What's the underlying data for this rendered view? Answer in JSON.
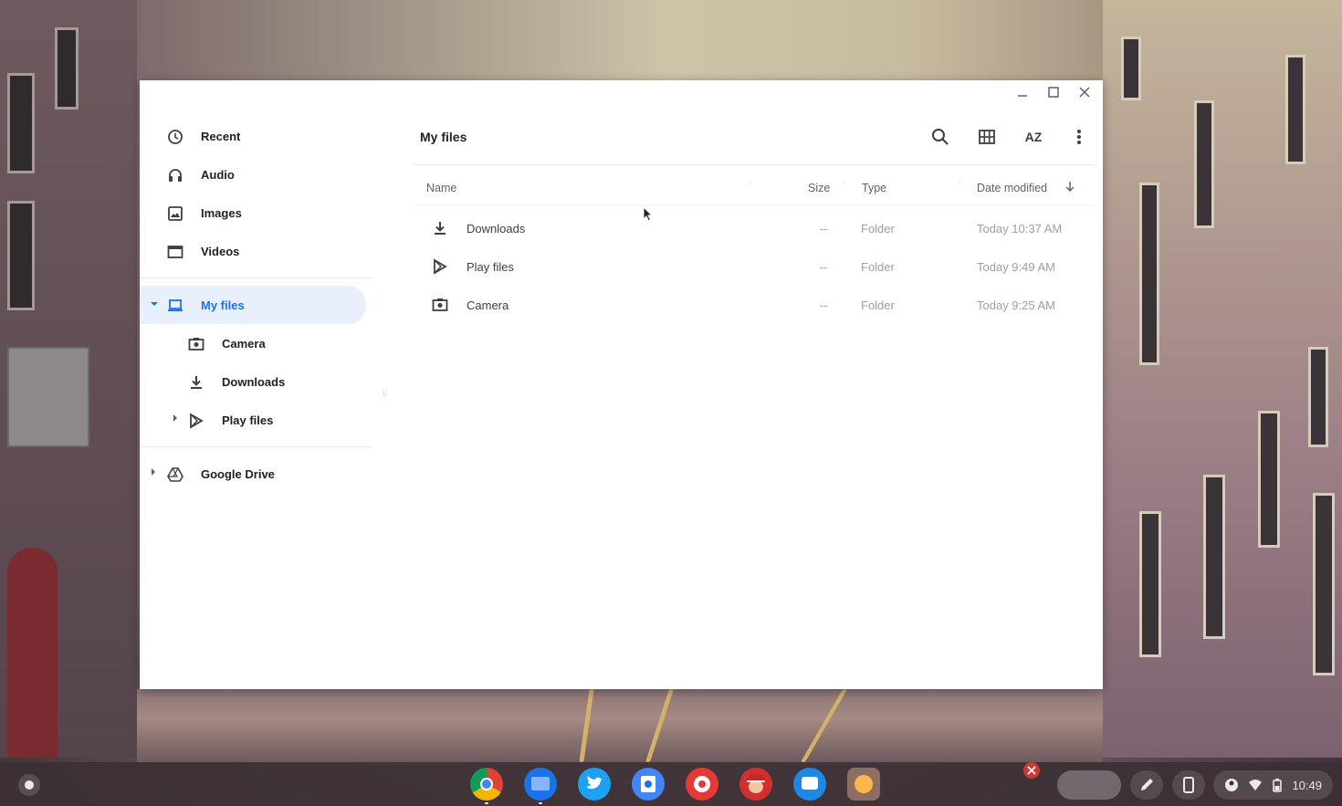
{
  "window": {
    "controls": [
      "–",
      "☐",
      "✕"
    ]
  },
  "sidebar": {
    "items": [
      {
        "label": "Recent",
        "icon": "clock-icon"
      },
      {
        "label": "Audio",
        "icon": "headphones-icon"
      },
      {
        "label": "Images",
        "icon": "image-icon"
      },
      {
        "label": "Videos",
        "icon": "video-icon"
      }
    ],
    "my_files": {
      "label": "My files",
      "icon": "laptop-icon",
      "expanded": true,
      "active": true
    },
    "my_files_children": [
      {
        "label": "Camera",
        "icon": "camera-icon"
      },
      {
        "label": "Downloads",
        "icon": "download-icon"
      },
      {
        "label": "Play files",
        "icon": "play-store-icon",
        "expandable": true
      }
    ],
    "google_drive": {
      "label": "Google Drive",
      "icon": "drive-icon"
    }
  },
  "main": {
    "title": "My files",
    "columns": {
      "name": "Name",
      "size": "Size",
      "type": "Type",
      "date": "Date modified"
    },
    "rows": [
      {
        "name": "Downloads",
        "size": "--",
        "type": "Folder",
        "date": "Today 10:37 AM",
        "icon": "download-icon"
      },
      {
        "name": "Play files",
        "size": "--",
        "type": "Folder",
        "date": "Today 9:49 AM",
        "icon": "play-store-icon"
      },
      {
        "name": "Camera",
        "size": "--",
        "type": "Folder",
        "date": "Today 9:25 AM",
        "icon": "camera-icon"
      }
    ],
    "sort_label": "AZ"
  },
  "shelf": {
    "apps": [
      "chrome-icon",
      "files-icon",
      "twitter-icon",
      "app-icon",
      "cake-icon",
      "mario-icon",
      "messages-icon",
      "squirrel-icon"
    ],
    "time": "10:49"
  }
}
